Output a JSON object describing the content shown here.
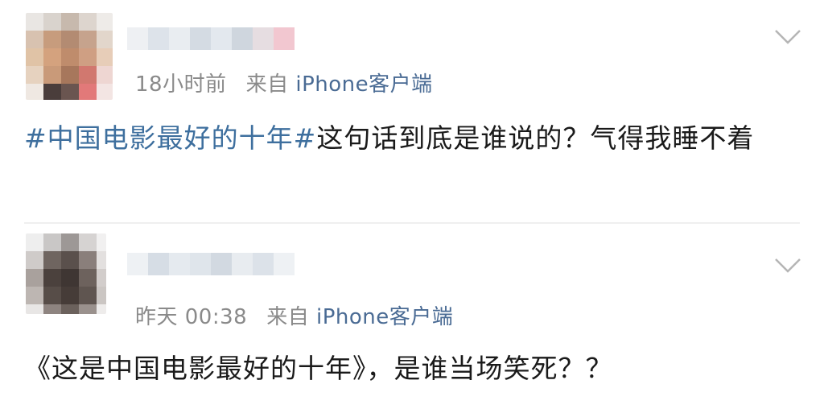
{
  "posts": [
    {
      "time": "18小时前",
      "source_prefix": "来自",
      "source_device": "iPhone客户端",
      "hashtag": "#中国电影最好的十年#",
      "text": "这句话到底是谁说的？气得我睡不着"
    },
    {
      "time": "昨天 00:38",
      "source_prefix": "来自",
      "source_device": "iPhone客户端",
      "text": "《这是中国电影最好的十年》，是谁当场笑死？？"
    }
  ],
  "icons": {
    "menu": "chevron-down-icon"
  },
  "colors": {
    "hashtag": "#3e6f9e",
    "meta": "#8a8a8a",
    "device": "#4a6b94",
    "text": "#1a1a1a"
  }
}
